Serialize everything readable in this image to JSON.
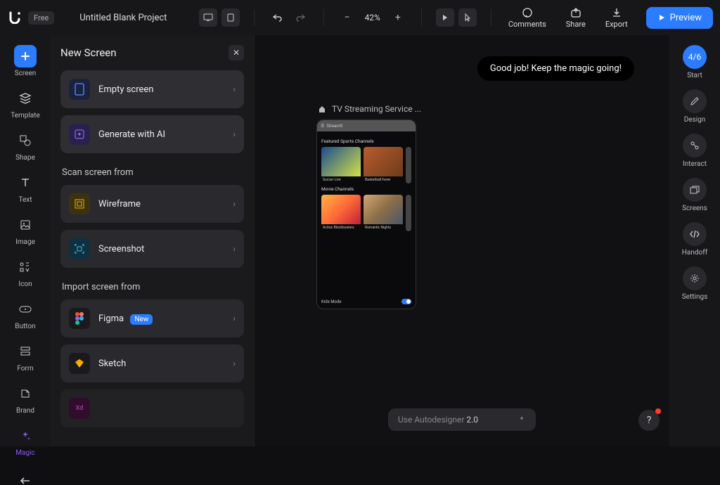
{
  "topbar": {
    "plan_label": "Free",
    "project_title": "Untitled Blank Project",
    "zoom": "42%",
    "actions": {
      "comments": "Comments",
      "share": "Share",
      "export": "Export",
      "preview": "Preview"
    }
  },
  "leftrail": {
    "items": [
      {
        "label": "Screen",
        "name": "screen"
      },
      {
        "label": "Template",
        "name": "template"
      },
      {
        "label": "Shape",
        "name": "shape"
      },
      {
        "label": "Text",
        "name": "text"
      },
      {
        "label": "Image",
        "name": "image"
      },
      {
        "label": "Icon",
        "name": "icon"
      },
      {
        "label": "Button",
        "name": "button"
      },
      {
        "label": "Form",
        "name": "form"
      },
      {
        "label": "Brand",
        "name": "brand"
      },
      {
        "label": "Magic",
        "name": "magic"
      }
    ]
  },
  "panel": {
    "title": "New Screen",
    "options": [
      {
        "label": "Empty screen"
      },
      {
        "label": "Generate with AI"
      }
    ],
    "scan_section": "Scan screen from",
    "scan_options": [
      {
        "label": "Wireframe"
      },
      {
        "label": "Screenshot"
      }
    ],
    "import_section": "Import screen from",
    "import_options": [
      {
        "label": "Figma",
        "badge": "New"
      },
      {
        "label": "Sketch"
      }
    ]
  },
  "canvas": {
    "breadcrumb": "TV Streaming Service ...",
    "phone": {
      "app_name": "StreamIt",
      "section1_title": "Featured Sports Channels",
      "section1_tiles": [
        {
          "cap": "Soccer Live"
        },
        {
          "cap": "Basketball Fever"
        }
      ],
      "section2_title": "Movie Channels",
      "section2_tiles": [
        {
          "cap": "Action Blockbusters"
        },
        {
          "cap": "Romantic Nights"
        }
      ],
      "footer_label": "Kids Mode"
    },
    "autodesigner_placeholder": "Use Autodesigner",
    "autodesigner_version": "2.0"
  },
  "toast": {
    "message": "Good job! Keep the magic going!"
  },
  "rightrail": {
    "progress": "4/6",
    "progress_label": "Start",
    "items": [
      {
        "label": "Design",
        "name": "design"
      },
      {
        "label": "Interact",
        "name": "interact"
      },
      {
        "label": "Screens",
        "name": "screens"
      },
      {
        "label": "Handoff",
        "name": "handoff"
      },
      {
        "label": "Settings",
        "name": "settings"
      }
    ]
  }
}
